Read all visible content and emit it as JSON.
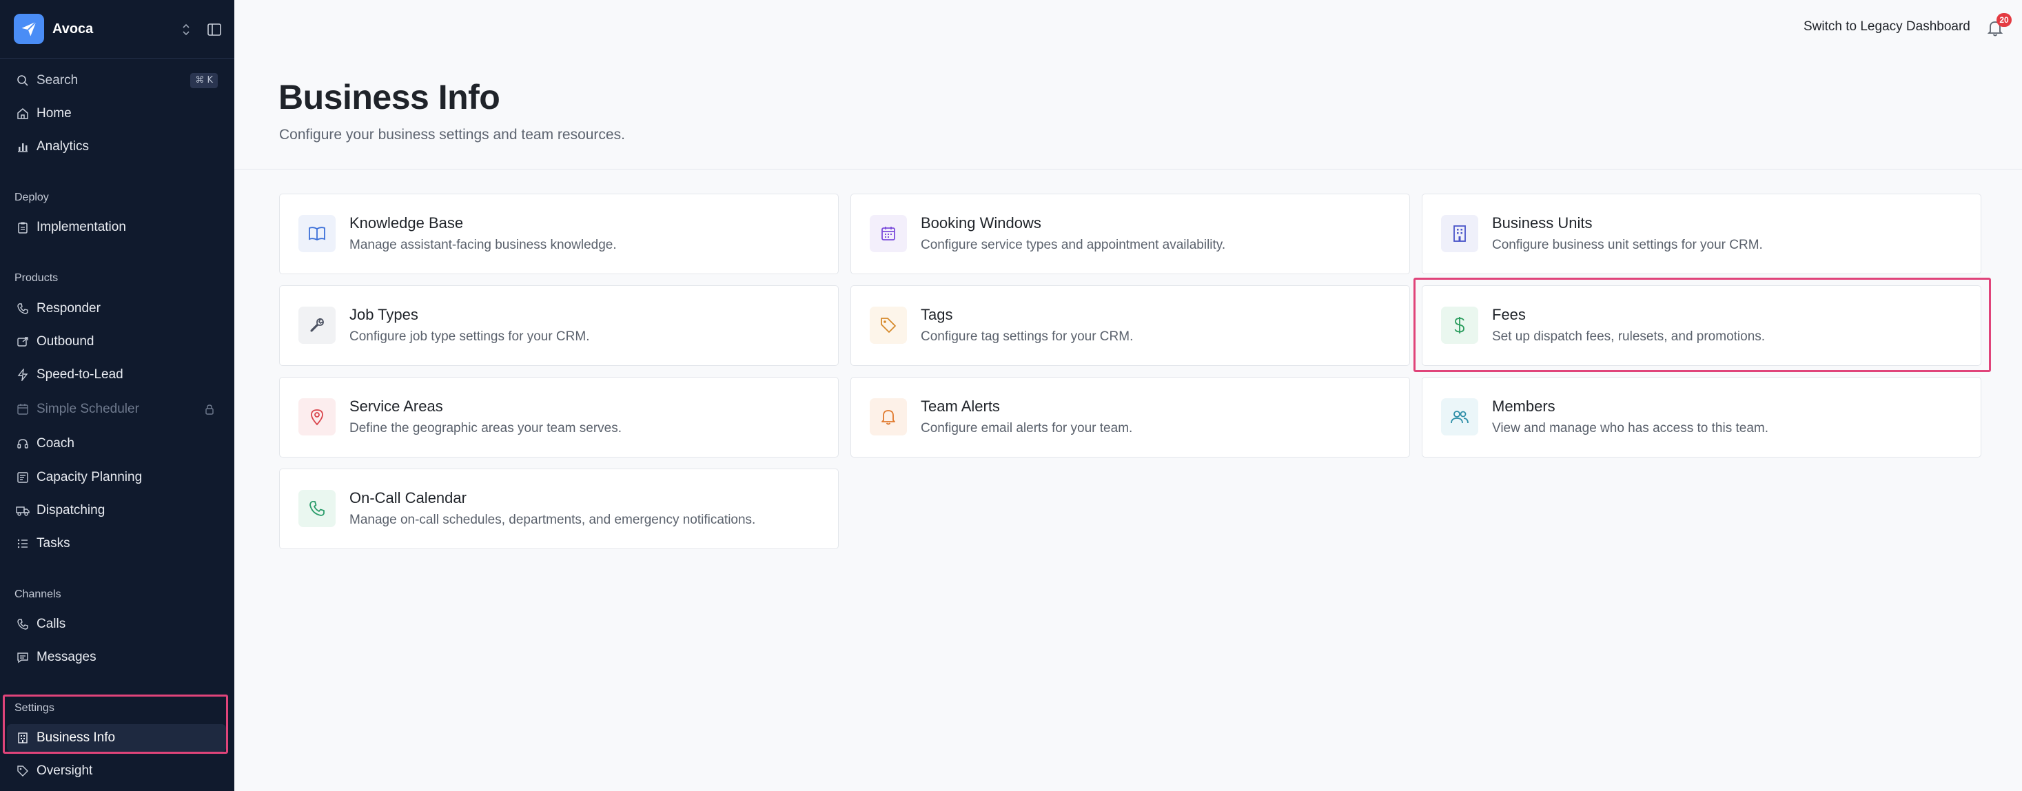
{
  "app": {
    "name": "Avoca",
    "logo_icon": "paper-plane-icon"
  },
  "sidebar": {
    "search": {
      "label": "Search",
      "shortcut": "⌘ K"
    },
    "top_items": [
      {
        "label": "Home",
        "icon": "home-icon"
      },
      {
        "label": "Analytics",
        "icon": "bar-chart-icon"
      }
    ],
    "sections": [
      {
        "label": "Deploy",
        "items": [
          {
            "label": "Implementation",
            "icon": "clipboard-icon"
          }
        ]
      },
      {
        "label": "Products",
        "items": [
          {
            "label": "Responder",
            "icon": "phone-icon"
          },
          {
            "label": "Outbound",
            "icon": "outbound-icon"
          },
          {
            "label": "Speed-to-Lead",
            "icon": "lightning-icon"
          },
          {
            "label": "Simple Scheduler",
            "icon": "calendar-icon",
            "disabled": true,
            "locked": true
          },
          {
            "label": "Coach",
            "icon": "headset-icon"
          },
          {
            "label": "Capacity Planning",
            "icon": "sliders-icon"
          },
          {
            "label": "Dispatching",
            "icon": "truck-icon"
          },
          {
            "label": "Tasks",
            "icon": "list-icon"
          }
        ]
      },
      {
        "label": "Channels",
        "items": [
          {
            "label": "Calls",
            "icon": "phone-icon"
          },
          {
            "label": "Messages",
            "icon": "message-icon"
          }
        ]
      },
      {
        "label": "Settings",
        "items": [
          {
            "label": "Business Info",
            "icon": "building-icon",
            "active": true
          },
          {
            "label": "Oversight",
            "icon": "tag-icon"
          }
        ]
      }
    ]
  },
  "header": {
    "legacy_link": "Switch to Legacy Dashboard",
    "notification_count": "20"
  },
  "page": {
    "title": "Business Info",
    "subtitle": "Configure your business settings and team resources."
  },
  "cards": [
    {
      "title": "Knowledge Base",
      "description": "Manage assistant-facing business knowledge.",
      "icon": "book-icon",
      "color": "#3b6fd8",
      "tile": "#eef2fb"
    },
    {
      "title": "Booking Windows",
      "description": "Configure service types and appointment availability.",
      "icon": "calendar-icon",
      "color": "#7c4ddb",
      "tile": "#f3effb"
    },
    {
      "title": "Business Units",
      "description": "Configure business unit settings for your CRM.",
      "icon": "building-icon",
      "color": "#4a55c9",
      "tile": "#eff0fa"
    },
    {
      "title": "Job Types",
      "description": "Configure job type settings for your CRM.",
      "icon": "wrench-icon",
      "color": "#4a5060",
      "tile": "#f1f2f4"
    },
    {
      "title": "Tags",
      "description": "Configure tag settings for your CRM.",
      "icon": "tag-icon",
      "color": "#d6892a",
      "tile": "#fdf5ea"
    },
    {
      "title": "Fees",
      "description": "Set up dispatch fees, rulesets, and promotions.",
      "icon": "dollar-icon",
      "color": "#2a9c5d",
      "tile": "#eaf7ef"
    },
    {
      "title": "Service Areas",
      "description": "Define the geographic areas your team serves.",
      "icon": "map-pin-icon",
      "color": "#d9434b",
      "tile": "#fcedee"
    },
    {
      "title": "Team Alerts",
      "description": "Configure email alerts for your team.",
      "icon": "bell-icon",
      "color": "#e0792c",
      "tile": "#fdf1e8"
    },
    {
      "title": "Members",
      "description": "View and manage who has access to this team.",
      "icon": "users-icon",
      "color": "#2f8fa8",
      "tile": "#ebf6f9"
    },
    {
      "title": "On-Call Calendar",
      "description": "Manage on-call schedules, departments, and emergency notifications.",
      "icon": "phone-icon",
      "color": "#2a9c6a",
      "tile": "#eaf7f0"
    }
  ]
}
